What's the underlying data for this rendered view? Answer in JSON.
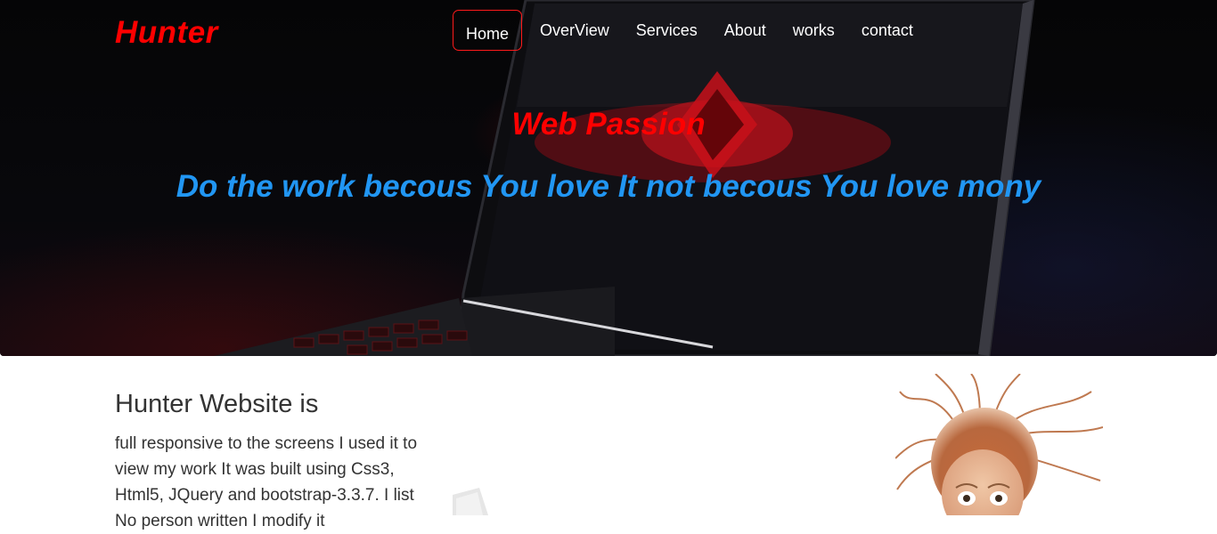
{
  "header": {
    "logo": "Hunter",
    "nav": [
      {
        "label": "Home",
        "active": true
      },
      {
        "label": "OverView",
        "active": false
      },
      {
        "label": "Services",
        "active": false
      },
      {
        "label": "About",
        "active": false
      },
      {
        "label": "works",
        "active": false
      },
      {
        "label": "contact",
        "active": false
      }
    ]
  },
  "hero": {
    "title": "Web Passion",
    "tagline": "Do the work becous You love It not becous You love mony"
  },
  "about": {
    "heading": "Hunter Website is",
    "text": "full responsive to the screens I used it to view my work It was built using Css3, Html5, JQuery and bootstrap-3.3.7. I list No person written I modify it"
  },
  "colors": {
    "accent_red": "#ff0000",
    "tagline_blue": "#2196f3",
    "text_dark": "#333333"
  }
}
